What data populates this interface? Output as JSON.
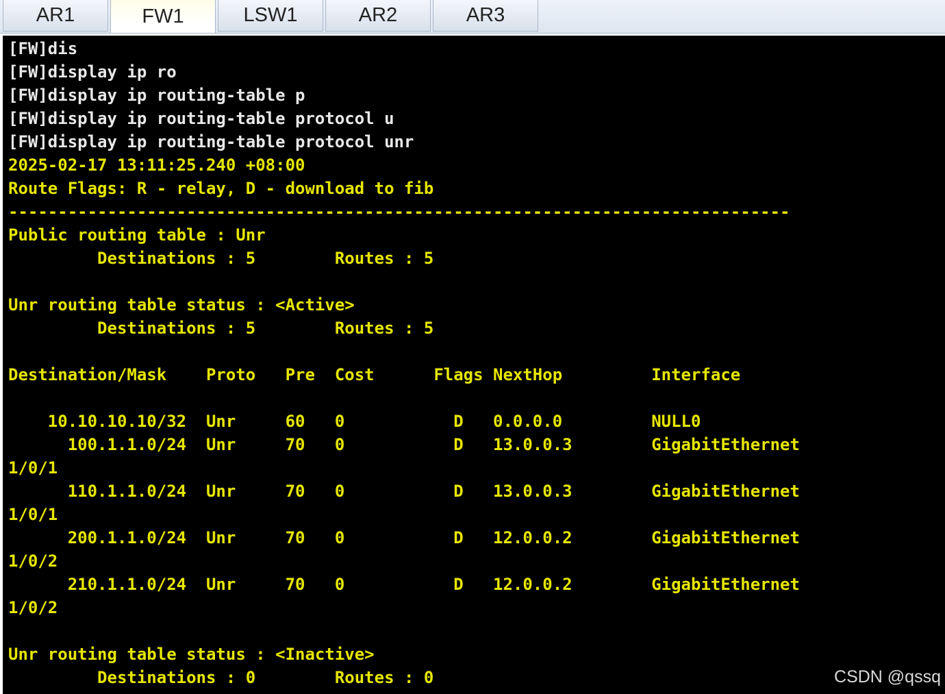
{
  "colors": {
    "terminal_bg": "#000000",
    "text_yellow": "#e6e600",
    "text_command": "#e8e8e8",
    "tab_active_bg": "#fffde6"
  },
  "tabs": [
    {
      "label": "AR1",
      "active": false
    },
    {
      "label": "FW1",
      "active": true
    },
    {
      "label": "LSW1",
      "active": false
    },
    {
      "label": "AR2",
      "active": false
    },
    {
      "label": "AR3",
      "active": false
    }
  ],
  "terminal": {
    "lines": [
      "[FW]dis",
      "[FW]display ip ro",
      "[FW]display ip routing-table p",
      "[FW]display ip routing-table protocol u",
      "[FW]display ip routing-table protocol unr",
      "2025-02-17 13:11:25.240 +08:00",
      "Route Flags: R - relay, D - download to fib",
      "-------------------------------------------------------------------------------",
      "Public routing table : Unr",
      "         Destinations : 5        Routes : 5",
      "",
      "Unr routing table status : <Active>",
      "         Destinations : 5        Routes : 5",
      "",
      "Destination/Mask    Proto   Pre  Cost      Flags NextHop         Interface",
      "",
      "    10.10.10.10/32  Unr     60   0           D   0.0.0.0         NULL0",
      "      100.1.1.0/24  Unr     70   0           D   13.0.0.3        GigabitEthernet",
      "1/0/1",
      "      110.1.1.0/24  Unr     70   0           D   13.0.0.3        GigabitEthernet",
      "1/0/1",
      "      200.1.1.0/24  Unr     70   0           D   12.0.0.2        GigabitEthernet",
      "1/0/2",
      "      210.1.1.0/24  Unr     70   0           D   12.0.0.2        GigabitEthernet",
      "1/0/2",
      "",
      "Unr routing table status : <Inactive>",
      "         Destinations : 0        Routes : 0"
    ]
  },
  "watermark": "CSDN @qssq"
}
